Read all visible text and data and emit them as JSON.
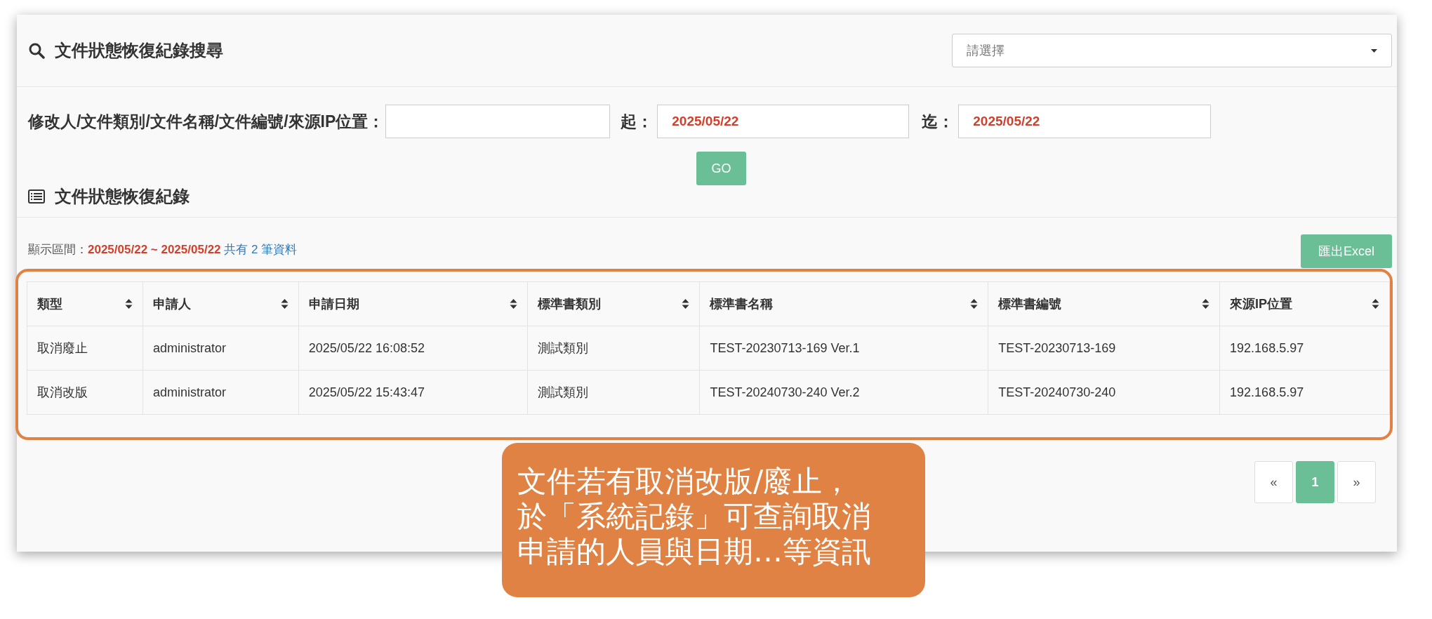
{
  "search_panel": {
    "title": "文件狀態恢復紀錄搜尋",
    "dropdown": {
      "placeholder": "請選擇"
    }
  },
  "filters": {
    "keyword_label": "修改人/文件類別/文件名稱/文件編號/來源IP位置：",
    "from_label": "起：",
    "from_value": "2025/05/22",
    "to_label": "迄：",
    "to_value": "2025/05/22",
    "go_button": "GO"
  },
  "records": {
    "title": "文件狀態恢復紀錄",
    "range_label": "顯示區間：",
    "range": "2025/05/22 ~ 2025/05/22",
    "count_text": "共有 2 筆資料",
    "export_button": "匯出Excel",
    "table": {
      "columns": [
        "類型",
        "申請人",
        "申請日期",
        "標準書類別",
        "標準書名稱",
        "標準書編號",
        "來源IP位置"
      ],
      "rows": [
        [
          "取消廢止",
          "administrator",
          "2025/05/22 16:08:52",
          "測試類別",
          "TEST-20230713-169 Ver.1",
          "TEST-20230713-169",
          "192.168.5.97"
        ],
        [
          "取消改版",
          "administrator",
          "2025/05/22 15:43:47",
          "測試類別",
          "TEST-20240730-240 Ver.2",
          "TEST-20240730-240",
          "192.168.5.97"
        ]
      ]
    },
    "pagination": [
      {
        "label": "«",
        "selected": false
      },
      {
        "label": "1",
        "selected": true
      },
      {
        "label": "»",
        "selected": false
      }
    ]
  },
  "callout": {
    "lines": [
      "文件若有取消改版/廢止，",
      "於「系統記錄」可查詢取消",
      "申請的人員與日期…等資訊"
    ]
  }
}
